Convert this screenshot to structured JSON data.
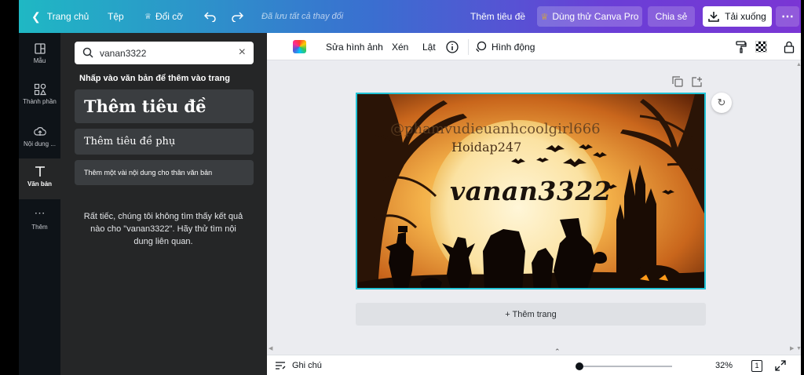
{
  "topbar": {
    "home": "Trang chủ",
    "file": "Tệp",
    "resize": "Đổi cỡ",
    "save_status": "Đã lưu tất cả thay đổi",
    "design_title": "Thêm tiêu đề",
    "try_pro": "Dùng thử Canva Pro",
    "share": "Chia sẻ",
    "download": "Tải xuống"
  },
  "rail": {
    "items": [
      {
        "label": "Mẫu",
        "icon": "layout-icon"
      },
      {
        "label": "Thành phần",
        "icon": "shapes-icon"
      },
      {
        "label": "Nội dung ...",
        "icon": "cloud-upload-icon"
      },
      {
        "label": "Văn bản",
        "icon": "text-icon"
      },
      {
        "label": "Thêm",
        "icon": "more-icon"
      }
    ]
  },
  "panel": {
    "search_value": "vanan3322",
    "hint": "Nhấp vào văn bản để thêm vào trang",
    "heading_btn": "Thêm tiêu đề",
    "subheading_btn": "Thêm tiêu đề phụ",
    "body_btn": "Thêm một vài nội dung cho thân văn bản",
    "no_result": "Rất tiếc, chúng tôi không tìm thấy kết quả nào cho \"vanan3322\". Hãy thử tìm nội dung liên quan."
  },
  "ctx": {
    "edit_image": "Sửa hình ảnh",
    "crop": "Xén",
    "flip": "Lật",
    "animate": "Hình động"
  },
  "design": {
    "watermark1": "@phamvudieuanhcoolgirl666",
    "watermark2": "Hoidap247",
    "title": "vanan3322"
  },
  "canvas": {
    "add_page": "+ Thêm trang"
  },
  "bottom": {
    "notes": "Ghi chú",
    "zoom": "32%",
    "page_count": "1",
    "zoom_level": 0.02
  },
  "colors": {
    "accent": "#21c3d6",
    "pro_crown": "#f5b800"
  }
}
